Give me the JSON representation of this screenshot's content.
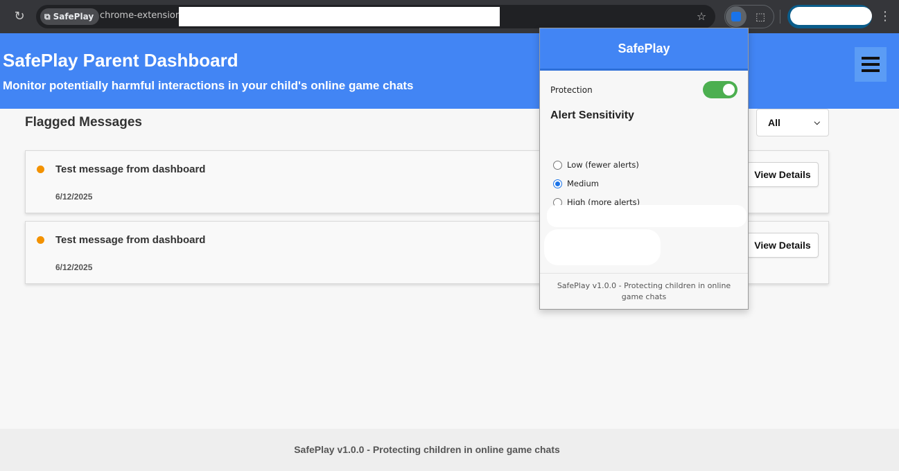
{
  "browser": {
    "reload_icon": "reload-icon",
    "site_chip": "SafePlay",
    "url_visible": "chrome-extension://",
    "star_icon": "star-icon",
    "extension_icon": "safeplay-extension-icon",
    "puzzle_icon": "puzzle-icon",
    "menu_icon": "kebab-menu-icon"
  },
  "header": {
    "title": "SafePlay Parent Dashboard",
    "subtitle": "Monitor potentially harmful interactions in your child's online game chats",
    "bg_color": "#4285f4"
  },
  "main": {
    "section_title": "Flagged Messages",
    "filter_value": "All",
    "messages": [
      {
        "title": "Test message from dashboard",
        "date": "6/12/2025",
        "button": "View Details",
        "severity_color": "#f39200"
      },
      {
        "title": "Test message from dashboard",
        "date": "6/12/2025",
        "button": "View Details",
        "severity_color": "#f39200"
      }
    ]
  },
  "footer": {
    "text": "SafePlay v1.0.0 - Protecting children in online game chats"
  },
  "popup": {
    "title": "SafePlay",
    "protection_label": "Protection",
    "protection_on": true,
    "sensitivity_title": "Alert Sensitivity",
    "options": [
      {
        "label": "Low (fewer alerts)",
        "checked": false
      },
      {
        "label": "Medium",
        "checked": true
      },
      {
        "label": "High (more alerts)",
        "checked": false
      }
    ],
    "footer": "SafePlay v1.0.0 - Protecting children in online game chats"
  }
}
